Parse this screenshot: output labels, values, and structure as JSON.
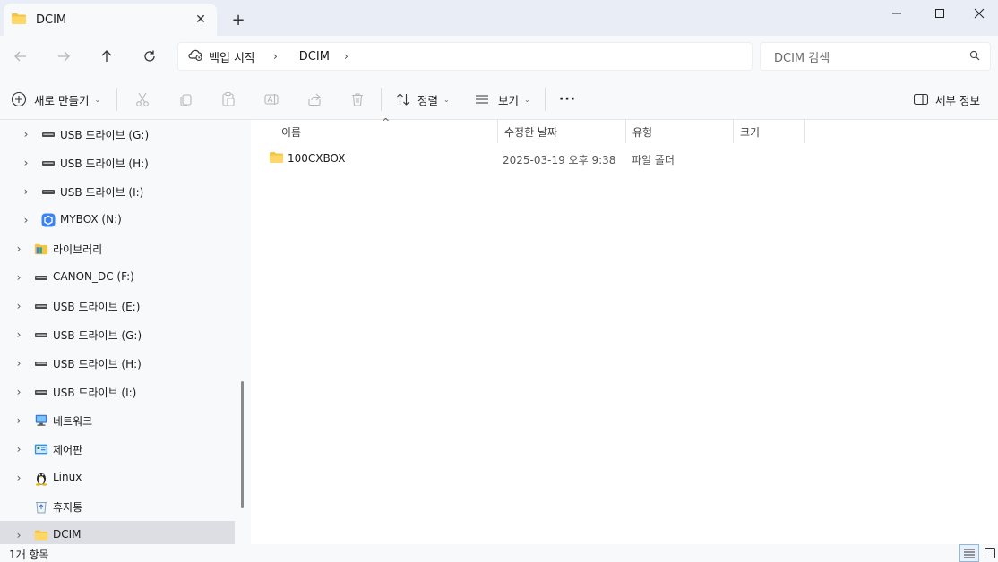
{
  "window": {
    "tab_title": "DCIM",
    "tab_close": "✕",
    "new_tab": "+",
    "tab_icon": "folder-icon"
  },
  "address_bar": {
    "crumbs": [
      "백업 시작",
      "DCIM"
    ],
    "separator": "›",
    "search_placeholder": "DCIM 검색"
  },
  "command_bar": {
    "new_label": "새로 만들기",
    "sort_label": "정렬",
    "view_label": "보기",
    "more_label": "···",
    "details_label": "세부 정보"
  },
  "sidebar": {
    "items": [
      {
        "label": "USB 드라이브 (G:)",
        "icon": "usb-drive-icon",
        "level": 1,
        "expander": true
      },
      {
        "label": "USB 드라이브 (H:)",
        "icon": "usb-drive-icon",
        "level": 1,
        "expander": true
      },
      {
        "label": "USB 드라이브 (I:)",
        "icon": "usb-drive-icon",
        "level": 1,
        "expander": true
      },
      {
        "label": "MYBOX (N:)",
        "icon": "mybox-icon",
        "level": 1,
        "expander": true
      },
      {
        "label": "라이브러리",
        "icon": "library-icon",
        "level": 0,
        "expander": true
      },
      {
        "label": "CANON_DC (F:)",
        "icon": "drive-icon",
        "level": 0,
        "expander": true
      },
      {
        "label": "USB 드라이브 (E:)",
        "icon": "usb-drive-icon",
        "level": 0,
        "expander": true
      },
      {
        "label": "USB 드라이브 (G:)",
        "icon": "usb-drive-icon",
        "level": 0,
        "expander": true
      },
      {
        "label": "USB 드라이브 (H:)",
        "icon": "usb-drive-icon",
        "level": 0,
        "expander": true
      },
      {
        "label": "USB 드라이브 (I:)",
        "icon": "usb-drive-icon",
        "level": 0,
        "expander": true
      },
      {
        "label": "네트워크",
        "icon": "network-icon",
        "level": 0,
        "expander": true
      },
      {
        "label": "제어판",
        "icon": "control-panel-icon",
        "level": 0,
        "expander": true
      },
      {
        "label": "Linux",
        "icon": "linux-icon",
        "level": 0,
        "expander": true
      },
      {
        "label": "휴지통",
        "icon": "recycle-bin-icon",
        "level": 0,
        "expander": false
      },
      {
        "label": "DCIM",
        "icon": "folder-icon",
        "level": 0,
        "expander": true,
        "selected": true
      }
    ]
  },
  "file_list": {
    "columns": [
      "이름",
      "수정한 날짜",
      "유형",
      "크기"
    ],
    "rows": [
      {
        "name": "100CXBOX",
        "modified": "2025-03-19 오후 9:38",
        "type": "파일 폴더",
        "size": ""
      }
    ]
  },
  "status_bar": {
    "item_count": "1개 항목"
  },
  "colors": {
    "accent": "#0067c0",
    "folder": "#f6c445",
    "selected_bg": "#dcdee3"
  }
}
